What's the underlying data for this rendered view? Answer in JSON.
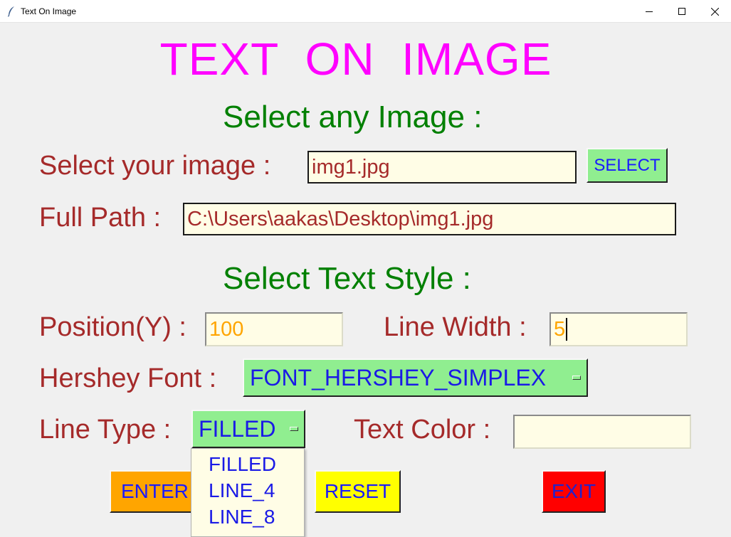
{
  "window": {
    "title": "Text On Image",
    "controls": [
      "minimize-icon",
      "maximize-icon",
      "close-icon"
    ]
  },
  "heading": "TEXT  ON  IMAGE",
  "select_image": {
    "section_title": "Select any Image :",
    "image_label": "Select your image  :",
    "image_value": "img1.jpg",
    "select_button": "SELECT",
    "path_label": "Full Path :",
    "path_value": "C:\\Users\\aakas\\Desktop\\img1.jpg"
  },
  "text_style": {
    "section_title": "Select Text Style :",
    "position_label": "Position(Y) :",
    "position_value": "100",
    "line_width_label": "Line Width :",
    "line_width_value": "5",
    "font_label": "Hershey Font :",
    "font_value": "FONT_HERSHEY_SIMPLEX",
    "line_type_label": "Line Type :",
    "line_type_value": "FILLED",
    "line_type_options": [
      "FILLED",
      "LINE_4",
      "LINE_8"
    ],
    "text_color_label": "Text Color :",
    "text_color_value": ""
  },
  "buttons": {
    "enter": "ENTER",
    "reset": "RESET",
    "exit": "EXIT"
  },
  "colors": {
    "heading": "#ff00ff",
    "section": "#008000",
    "label": "#a52a2a",
    "entry_bg": "#fffde6",
    "select_bg": "#90ee90",
    "enter_bg": "#ffa500",
    "reset_bg": "#ffff00",
    "exit_bg": "#ff0000",
    "button_text": "#1a1aff"
  }
}
